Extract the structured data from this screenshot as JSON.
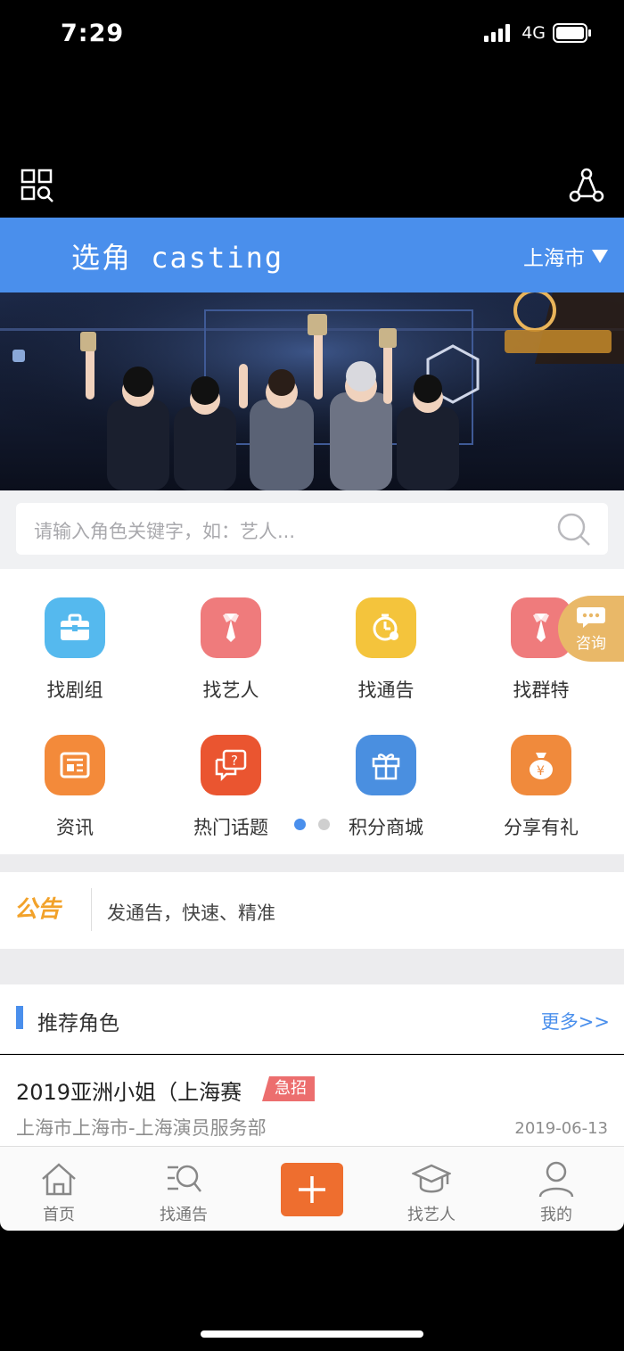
{
  "status_bar": {
    "time": "7:29",
    "network": "4G"
  },
  "header": {
    "title": "选角 casting",
    "city": "上海市"
  },
  "search": {
    "placeholder": "请输入角色关键字，如：艺人..."
  },
  "grid": {
    "items": [
      {
        "label": "找剧组",
        "icon": "briefcase-icon",
        "color": "#55b9ee"
      },
      {
        "label": "找艺人",
        "icon": "necktie-icon",
        "color": "#ef7b7c"
      },
      {
        "label": "找通告",
        "icon": "clock-icon",
        "color": "#f4c43c"
      },
      {
        "label": "找群特",
        "icon": "necktie-icon",
        "color": "#ef7b7c"
      },
      {
        "label": "资讯",
        "icon": "news-icon",
        "color": "#f38a3a"
      },
      {
        "label": "热门话题",
        "icon": "chat-question-icon",
        "color": "#ea5530"
      },
      {
        "label": "积分商城",
        "icon": "gift-icon",
        "color": "#4a8fe0"
      },
      {
        "label": "分享有礼",
        "icon": "money-bag-icon",
        "color": "#f08a3c"
      }
    ],
    "pager": {
      "pages": 2,
      "active": 1,
      "active_color": "#4a8fec",
      "inactive_color": "#cfcfcf"
    }
  },
  "consult": {
    "label": "咨询"
  },
  "notice": {
    "logo": "公告",
    "text": "发通告，快速、精准"
  },
  "recommend": {
    "title": "推荐角色",
    "more": "更多>>",
    "items": [
      {
        "title": "2019亚洲小姐（上海赛",
        "tag": "急招",
        "org": "上海市上海市-上海演员服务部",
        "date": "2019-06-13"
      }
    ]
  },
  "tab_bar": {
    "tabs": [
      {
        "label": "首页",
        "icon": "home-icon"
      },
      {
        "label": "找通告",
        "icon": "search-list-icon"
      },
      {
        "label": "",
        "icon": "plus-icon"
      },
      {
        "label": "找艺人",
        "icon": "graduation-cap-icon"
      },
      {
        "label": "我的",
        "icon": "user-icon"
      }
    ]
  },
  "colors": {
    "primary": "#4a8fec",
    "accent": "#ee6e2f",
    "consult": "#e9b868",
    "tag": "#ec6e6e"
  }
}
